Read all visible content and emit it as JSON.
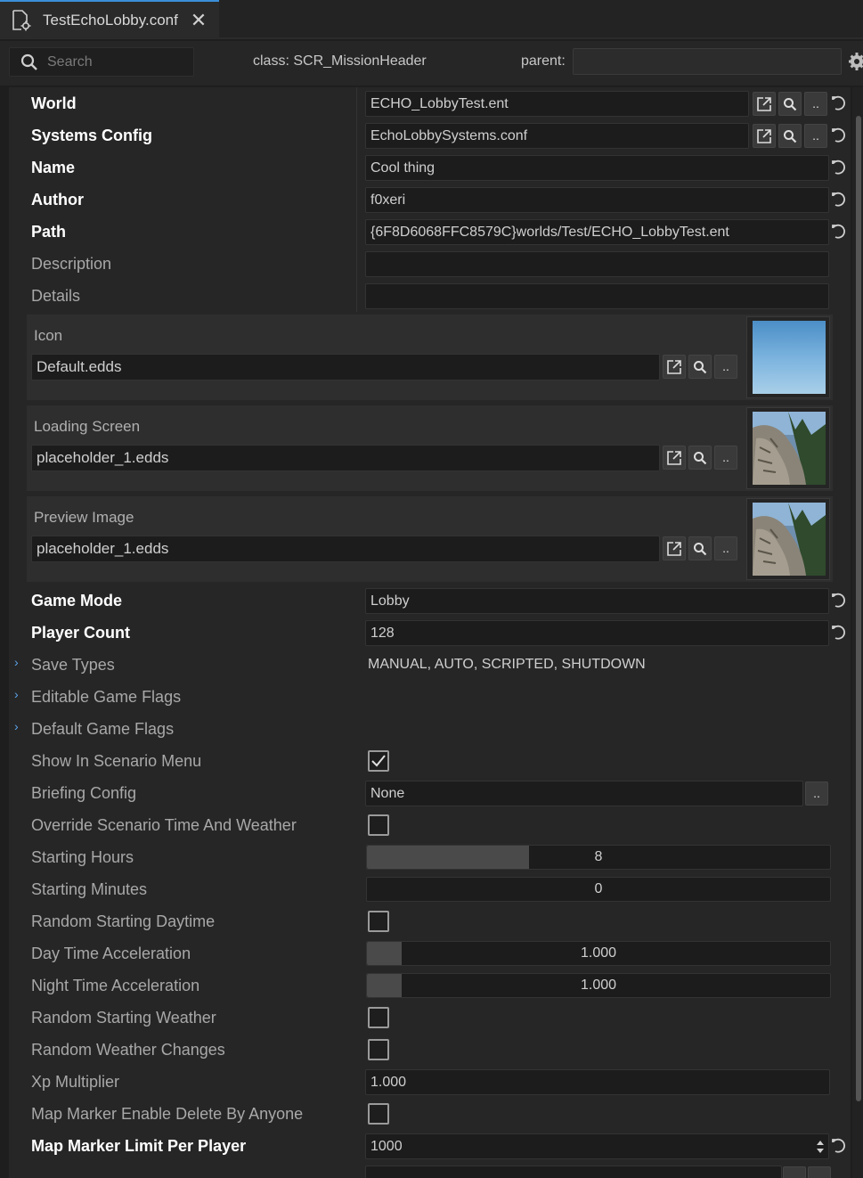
{
  "tab": {
    "title": "TestEchoLobby.conf",
    "icon": "config-file-icon"
  },
  "header": {
    "search_placeholder": "Search",
    "class_label": "class: SCR_MissionHeader",
    "parent_label": "parent:",
    "parent_value": ""
  },
  "properties": {
    "world": {
      "label": "World",
      "value": "ECHO_LobbyTest.ent"
    },
    "systems_config": {
      "label": "Systems Config",
      "value": "EchoLobbySystems.conf"
    },
    "name": {
      "label": "Name",
      "value": "Cool thing"
    },
    "author": {
      "label": "Author",
      "value": "f0xeri"
    },
    "path": {
      "label": "Path",
      "value": "{6F8D6068FFC8579C}worlds/Test/ECHO_LobbyTest.ent"
    },
    "description": {
      "label": "Description",
      "value": ""
    },
    "details": {
      "label": "Details",
      "value": ""
    },
    "icon": {
      "label": "Icon",
      "value": "Default.edds"
    },
    "loading_screen": {
      "label": "Loading Screen",
      "value": "placeholder_1.edds"
    },
    "preview_image": {
      "label": "Preview Image",
      "value": "placeholder_1.edds"
    },
    "game_mode": {
      "label": "Game Mode",
      "value": "Lobby"
    },
    "player_count": {
      "label": "Player Count",
      "value": "128"
    },
    "save_types": {
      "label": "Save Types",
      "value": "MANUAL, AUTO, SCRIPTED, SHUTDOWN"
    },
    "editable_game_flags": {
      "label": "Editable Game Flags"
    },
    "default_game_flags": {
      "label": "Default Game Flags"
    },
    "show_in_scenario_menu": {
      "label": "Show In Scenario Menu",
      "checked": true
    },
    "briefing_config": {
      "label": "Briefing Config",
      "value": "None"
    },
    "override_time_weather": {
      "label": "Override Scenario Time And Weather",
      "checked": false
    },
    "starting_hours": {
      "label": "Starting Hours",
      "value": "8",
      "fill": 0.35
    },
    "starting_minutes": {
      "label": "Starting Minutes",
      "value": "0",
      "fill": 0
    },
    "random_starting_daytime": {
      "label": "Random Starting Daytime",
      "checked": false
    },
    "day_time_acceleration": {
      "label": "Day Time Acceleration",
      "value": "1.000",
      "fill": 0.075
    },
    "night_time_acceleration": {
      "label": "Night Time Acceleration",
      "value": "1.000",
      "fill": 0.075
    },
    "random_starting_weather": {
      "label": "Random Starting Weather",
      "checked": false
    },
    "random_weather_changes": {
      "label": "Random Weather Changes",
      "checked": false
    },
    "xp_multiplier": {
      "label": "Xp Multiplier",
      "value": "1.000"
    },
    "map_marker_delete": {
      "label": "Map Marker Enable Delete By Anyone",
      "checked": false
    },
    "map_marker_limit": {
      "label": "Map Marker Limit Per Player",
      "value": "1000"
    }
  },
  "buttons": {
    "browse": ".."
  },
  "colors": {
    "accent": "#3b8fd9",
    "expand_arrow": "#5da4e8"
  }
}
